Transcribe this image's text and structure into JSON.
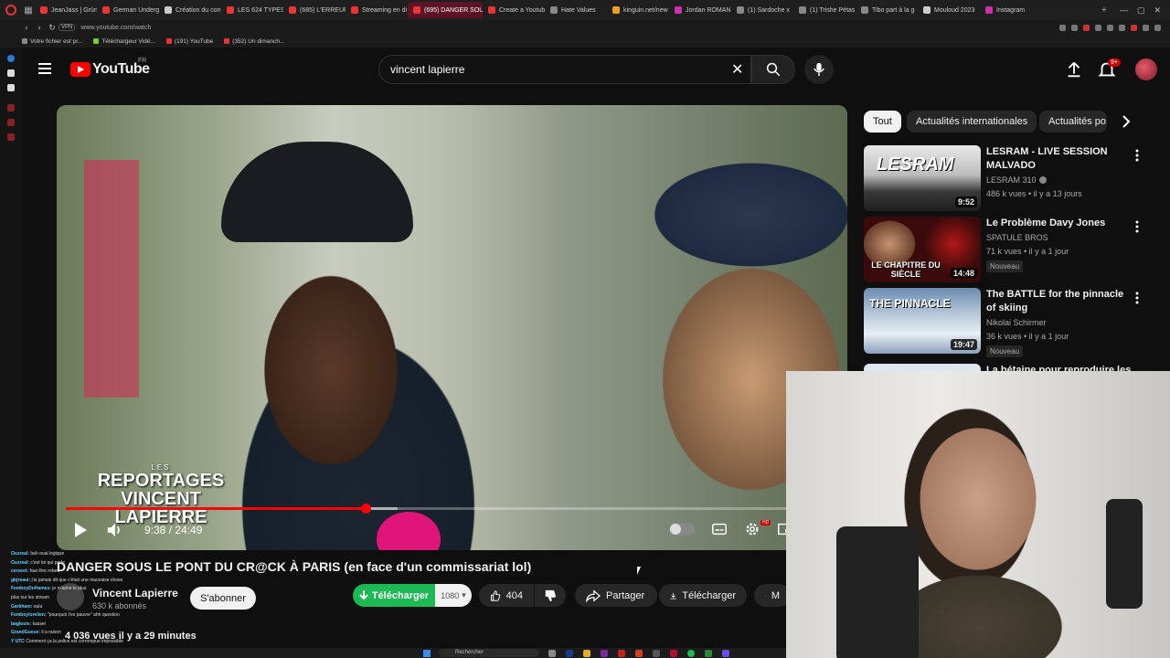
{
  "browser": {
    "tabs": [
      {
        "label": "JeanJass | Grün",
        "color": "#e33"
      },
      {
        "label": "German Underg",
        "color": "#e33"
      },
      {
        "label": "Création du con",
        "color": "#ccc"
      },
      {
        "label": "LES 624 TYPES",
        "color": "#e33"
      },
      {
        "label": "(685) L'ERREUR",
        "color": "#e33"
      },
      {
        "label": "Streaming en di",
        "color": "#e33"
      },
      {
        "label": "(695) DANGER SOUS",
        "color": "#e33",
        "active": true
      },
      {
        "label": "Create a Youtub",
        "color": "#e33"
      },
      {
        "label": "Hate Values",
        "color": "#888"
      },
      {
        "label": "kinguin.net/new",
        "color": "#f0a020"
      },
      {
        "label": "Jordan ROMANI",
        "color": "#c3a"
      },
      {
        "label": "(1) Sardoche x",
        "color": "#888"
      },
      {
        "label": "(1) Trishe Pétas",
        "color": "#888"
      },
      {
        "label": "Tibo part à la g",
        "color": "#888"
      },
      {
        "label": "Mouloud 2023",
        "color": "#ccc"
      },
      {
        "label": "Instagram",
        "color": "#c3a"
      }
    ],
    "new_tab": "+",
    "url": "www.youtube.com/watch",
    "bookmarks": [
      {
        "label": "Votre fichier est pr...",
        "color": "#888"
      },
      {
        "label": "Téléchargeur Vidé...",
        "color": "#7c3"
      },
      {
        "label": "(191) YouTube",
        "color": "#e33"
      },
      {
        "label": "(352) Un dimanch...",
        "color": "#e33"
      }
    ]
  },
  "header": {
    "logo_text": "YouTube",
    "region": "FR",
    "search_value": "vincent lapierre",
    "notification_count": "9+"
  },
  "player": {
    "watermark_small": "LES",
    "watermark_line1": "REPORTAGES",
    "watermark_line2": "VINCENT LAPIERRE",
    "time": "9:38 / 24:49",
    "progress_fraction": 0.388,
    "buffer_fraction": 0.43
  },
  "video": {
    "title": "DANGER SOUS LE PONT DU CR@CK À PARIS (en face d'un commissariat lol)",
    "channel": "Vincent Lapierre",
    "subscribers": "630 k abonnés",
    "subscribe_label": "S'abonner",
    "download_green_label": "Télécharger",
    "quality": "1080",
    "likes": "404",
    "share_label": "Partager",
    "download_label": "Télécharger",
    "more_label": "M",
    "views_line": "4 036 vues  il y a 29 minutes"
  },
  "chips": [
    "Tout",
    "Actualités internationales",
    "Actualités po"
  ],
  "recommendations": [
    {
      "title": "LESRAM - LIVE SESSION MALVADO",
      "channel": "LESRAM 310",
      "verified": true,
      "meta": "486 k vues • il y a 13 jours",
      "duration": "9:52",
      "badge": "",
      "thumb_text": "LESRAM"
    },
    {
      "title": "Le Problème Davy Jones",
      "channel": "SPATULE BROS",
      "verified": false,
      "meta": "71 k vues • il y a 1 jour",
      "duration": "14:48",
      "badge": "Nouveau",
      "thumb_text": "LE CHAPITRE DU SIÈCLE"
    },
    {
      "title": "The BATTLE for the pinnacle of skiing",
      "channel": "Nikolai Schirmer",
      "verified": false,
      "meta": "36 k vues • il y a 1 jour",
      "duration": "19:47",
      "badge": "Nouveau",
      "thumb_text": "THE PINNACLE"
    },
    {
      "title": "La bétaine pour reproduire les",
      "channel": "",
      "verified": false,
      "meta": "",
      "duration": "",
      "badge": "",
      "thumb_text": ""
    }
  ],
  "chat": [
    {
      "user": "Ouzreal:",
      "msg": "bah ouai logique"
    },
    {
      "user": "Ouzreal:",
      "msg": "c'est toi qui parle"
    },
    {
      "user": "cerseet:",
      "msg": "faut être rebeu"
    },
    {
      "user": "",
      "msg": ""
    },
    {
      "user": "gbjreaui:",
      "msg": "j'ai jamais dit que c'était une mauvaise chose"
    },
    {
      "user": "FemboyDuHames:",
      "msg": "je m'aime le plus"
    },
    {
      "user": "",
      "msg": "plus sur les stream"
    },
    {
      "user": "Garkham:",
      "msg": "oula"
    },
    {
      "user": "Femboylorelien:",
      "msg": "\"pourquoi t'es pauvre\" ahh question"
    },
    {
      "user": "",
      "msg": ""
    },
    {
      "user": "baglouis:",
      "msg": "kassel"
    },
    {
      "user": "GrandGueux:",
      "msg": "il a raison"
    },
    {
      "user": "Y UTC",
      "msg": "Comment ça la police est corrompue impossible"
    }
  ],
  "taskbar": {
    "search_label": "Rechercher"
  }
}
